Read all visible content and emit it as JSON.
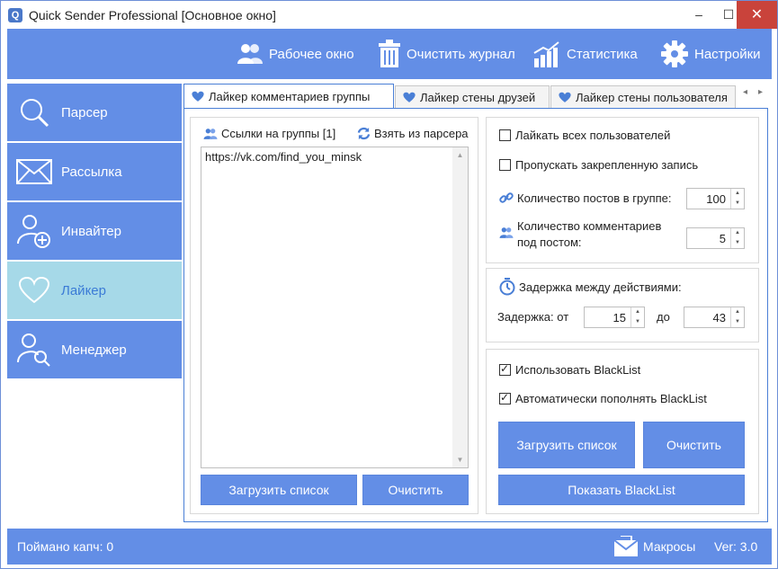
{
  "window": {
    "title": "Quick Sender Professional [Основное окно]",
    "app_icon_letter": "Q",
    "minimize": "‒",
    "maximize": "☐",
    "close": "✕"
  },
  "toolbar": {
    "work_window": "Рабочее окно",
    "clear_log": "Очистить журнал",
    "statistics": "Статистика",
    "settings": "Настройки"
  },
  "sidebar": {
    "items": [
      {
        "label": "Парсер",
        "icon": "search-icon"
      },
      {
        "label": "Рассылка",
        "icon": "envelope-icon"
      },
      {
        "label": "Инвайтер",
        "icon": "add-user-icon"
      },
      {
        "label": "Лайкер",
        "icon": "heart-icon",
        "active": true
      },
      {
        "label": "Менеджер",
        "icon": "user-search-icon"
      }
    ]
  },
  "tabs": [
    {
      "label": "Лайкер комментариев группы",
      "active": true
    },
    {
      "label": "Лайкер стены друзей"
    },
    {
      "label": "Лайкер стены пользователя"
    }
  ],
  "tab_arrows": {
    "left": "◂",
    "right": "▸"
  },
  "left_panel": {
    "links_label": "Ссылки на группы [1]",
    "from_parser": "Взять из парсера",
    "links_text": "https://vk.com/find_you_minsk",
    "load_button": "Загрузить список",
    "clear_button": "Очистить"
  },
  "settings_box": {
    "like_all": {
      "label": "Лайкать всех пользователей",
      "checked": false
    },
    "skip_pinned": {
      "label": "Пропускать закрепленную запись",
      "checked": false
    },
    "posts_count_label": "Количество постов в группе:",
    "posts_count_value": "100",
    "comments_count_label_1": "Количество комментариев",
    "comments_count_label_2": "под постом:",
    "comments_count_value": "5"
  },
  "delay_box": {
    "title": "Задержка между действиями:",
    "delay_label": "Задержка: от",
    "from_value": "15",
    "to_label": "до",
    "to_value": "43"
  },
  "blacklist_box": {
    "use_blacklist": {
      "label": "Использовать BlackList",
      "checked": true
    },
    "auto_fill": {
      "label": "Автоматически пополнять BlackList",
      "checked": true
    },
    "load_button": "Загрузить список",
    "clear_button": "Очистить",
    "show_button": "Показать BlackList"
  },
  "statusbar": {
    "captcha": "Поймано капч:   0",
    "macros": "Макросы",
    "version": "Ver: 3.0"
  },
  "colors": {
    "accent": "#638ee6",
    "active_side": "#a6d9e8",
    "close": "#c9433b"
  }
}
